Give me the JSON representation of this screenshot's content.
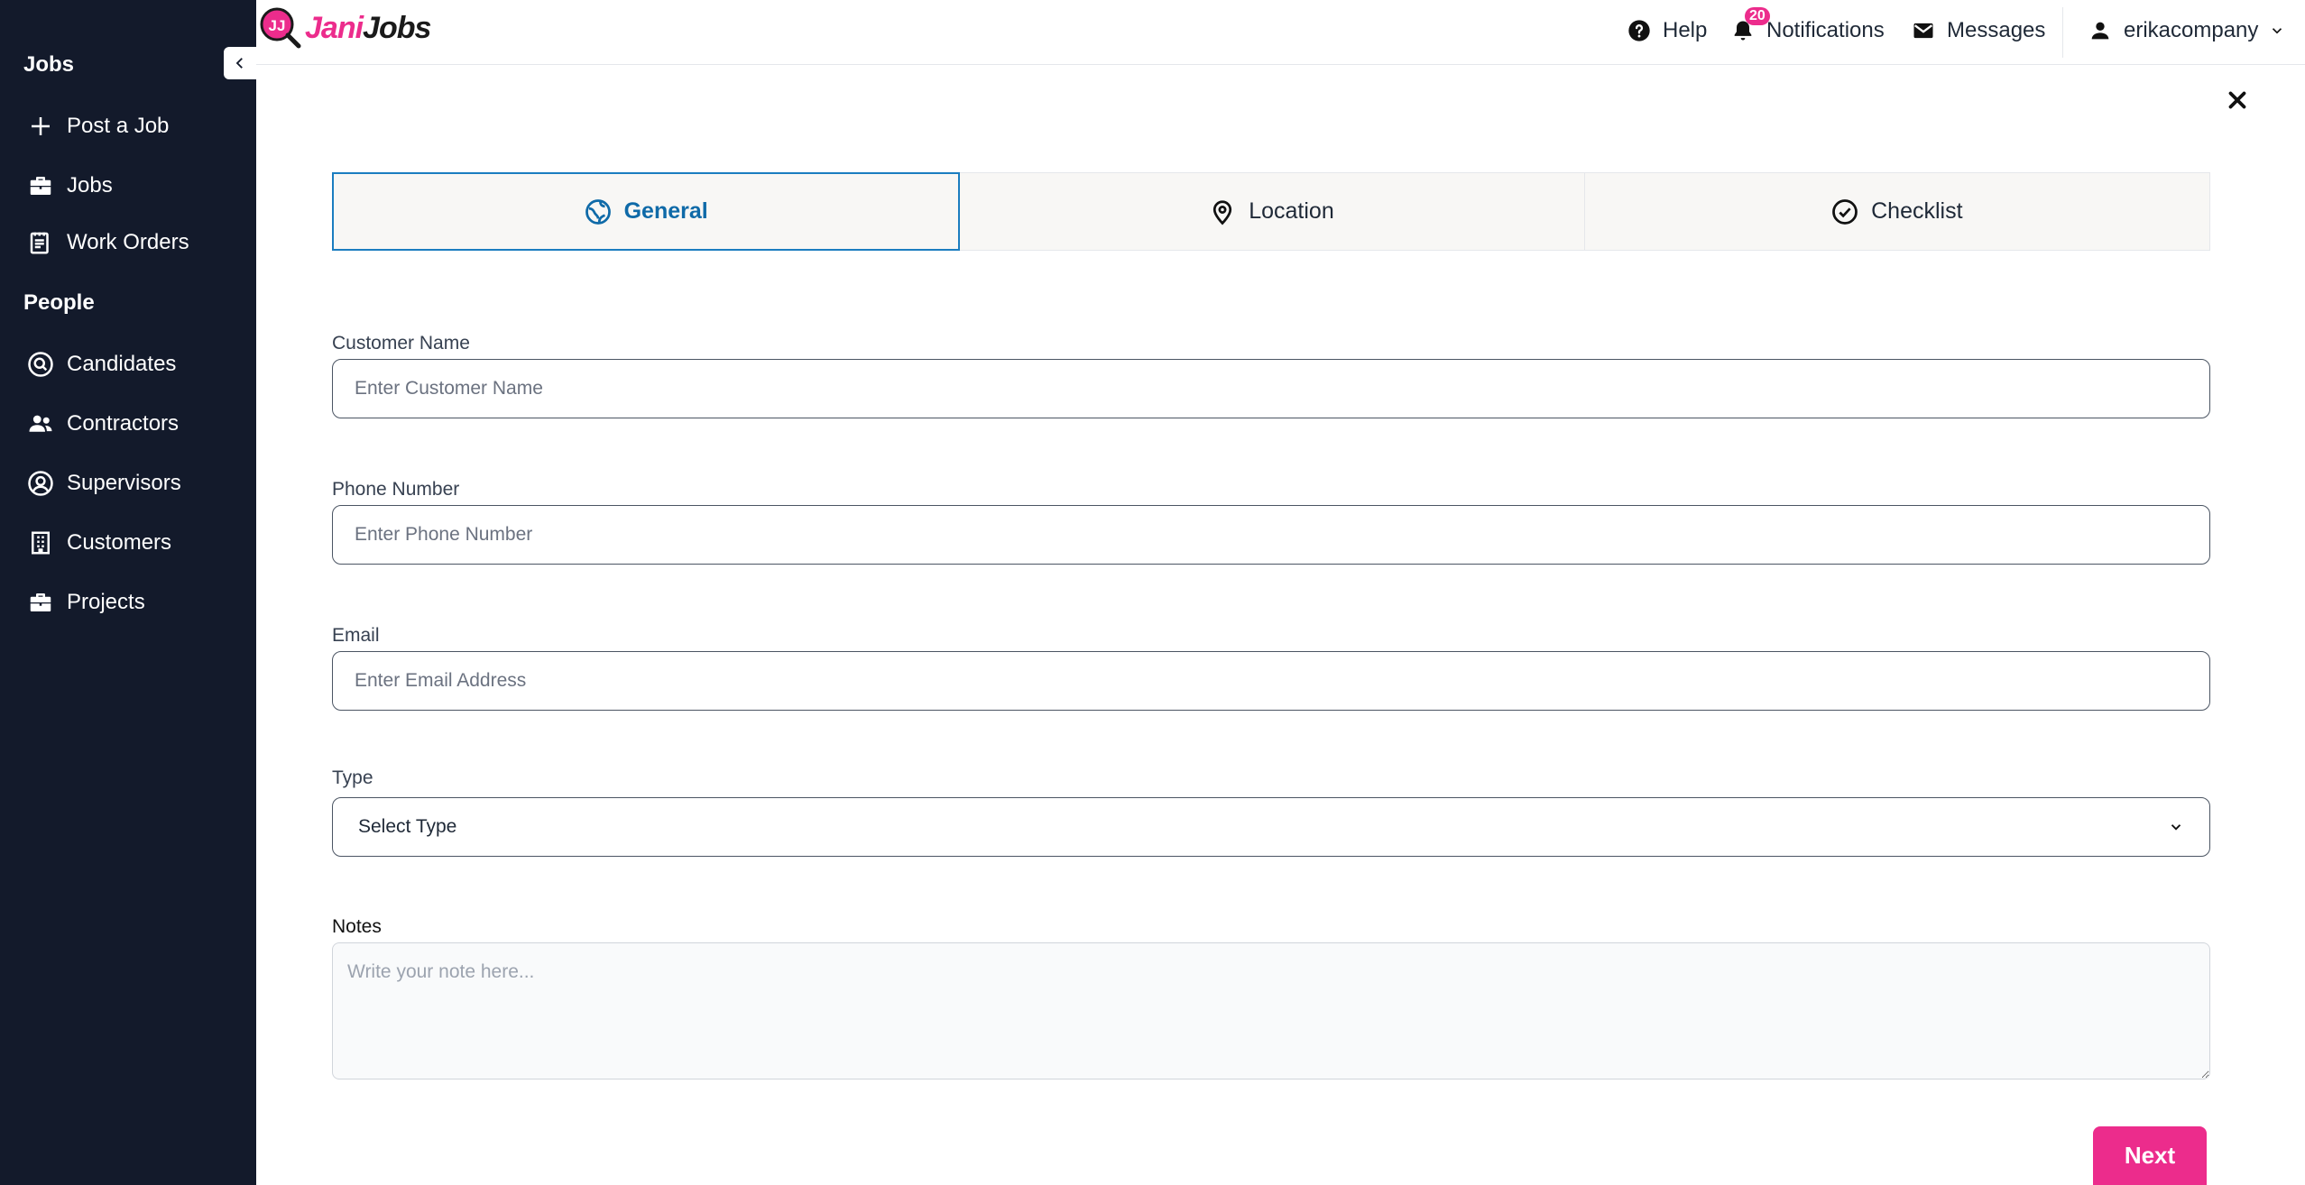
{
  "brand": {
    "name_part1": "Jani",
    "name_part2": "Jobs",
    "logo_letters": "JJ",
    "accent": "#ec2c8c"
  },
  "sidebar": {
    "sections": [
      {
        "heading": "Jobs",
        "items": [
          {
            "label": "Post a Job",
            "icon": "plus-icon"
          },
          {
            "label": "Jobs",
            "icon": "briefcase-icon"
          },
          {
            "label": "Work Orders",
            "icon": "clipboard-icon"
          }
        ]
      },
      {
        "heading": "People",
        "items": [
          {
            "label": "Candidates",
            "icon": "search-circle-icon"
          },
          {
            "label": "Contractors",
            "icon": "users-icon"
          },
          {
            "label": "Supervisors",
            "icon": "user-circle-icon"
          },
          {
            "label": "Customers",
            "icon": "building-icon"
          },
          {
            "label": "Projects",
            "icon": "briefcase-icon"
          }
        ]
      }
    ]
  },
  "topbar": {
    "help": "Help",
    "notifications": "Notifications",
    "notification_count": "20",
    "messages": "Messages",
    "user": "erikacompany"
  },
  "tabs": [
    {
      "label": "General",
      "icon": "globe-icon",
      "active": true
    },
    {
      "label": "Location",
      "icon": "map-pin-icon",
      "active": false
    },
    {
      "label": "Checklist",
      "icon": "check-circle-icon",
      "active": false
    }
  ],
  "form": {
    "customer_name": {
      "label": "Customer Name",
      "placeholder": "Enter Customer Name",
      "value": ""
    },
    "phone": {
      "label": "Phone Number",
      "placeholder": "Enter Phone Number",
      "value": ""
    },
    "email": {
      "label": "Email",
      "placeholder": "Enter Email Address",
      "value": ""
    },
    "type": {
      "label": "Type",
      "selected": "Select Type"
    },
    "notes": {
      "label": "Notes",
      "placeholder": "Write your note here..."
    }
  },
  "actions": {
    "next": "Next"
  },
  "colors": {
    "sidebar_bg": "#131a2b",
    "active_tab": "#1b7dc0",
    "primary": "#ec2c8c"
  }
}
